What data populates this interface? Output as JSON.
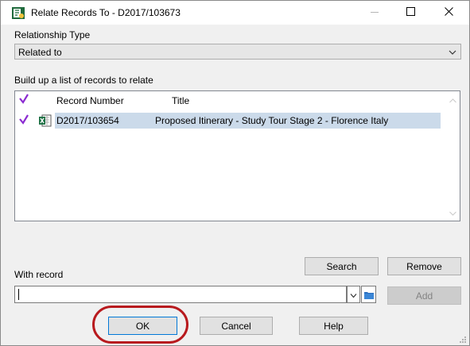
{
  "window": {
    "title": "Relate Records To - D2017/103673"
  },
  "relationship": {
    "label": "Relationship Type",
    "selected": "Related to"
  },
  "list": {
    "label": "Build up a list of records to relate",
    "columns": [
      "Record Number",
      "Title"
    ],
    "rows": [
      {
        "number": "D2017/103654",
        "title": "Proposed Itinerary - Study Tour Stage 2 - Florence Italy",
        "icon": "excel-icon",
        "checked": true
      }
    ]
  },
  "with_record": {
    "label": "With record",
    "value": "",
    "placeholder": ""
  },
  "buttons": {
    "search": "Search",
    "remove": "Remove",
    "add": "Add",
    "ok": "OK",
    "cancel": "Cancel",
    "help": "Help"
  },
  "colors": {
    "check": "#8b2bd1",
    "selection": "#cbdaea",
    "highlight_ring": "#b81a1e",
    "focus": "#0078d7"
  }
}
